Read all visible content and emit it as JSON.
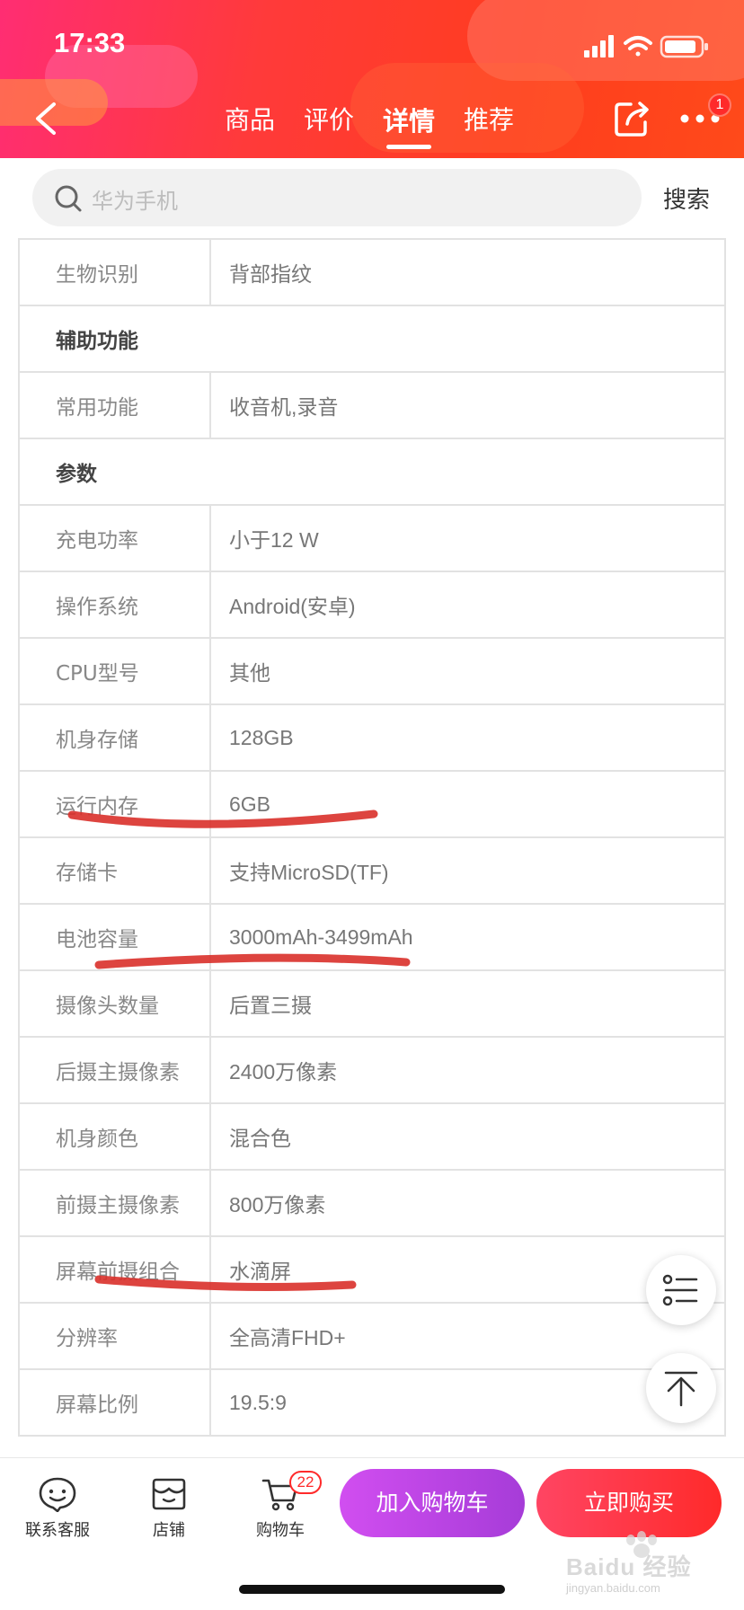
{
  "status_bar": {
    "time": "17:33"
  },
  "nav": {
    "tabs": [
      {
        "label": "商品"
      },
      {
        "label": "评价"
      },
      {
        "label": "详情"
      },
      {
        "label": "推荐"
      }
    ],
    "active_tab": "详情",
    "more_badge": "1"
  },
  "search": {
    "placeholder": "华为手机",
    "button_label": "搜索"
  },
  "specs": {
    "rows": [
      {
        "label": "生物识别",
        "value": "背部指纹"
      },
      {
        "section": "辅助功能"
      },
      {
        "label": "常用功能",
        "value": "收音机,录音"
      },
      {
        "section": "参数"
      },
      {
        "label": "充电功率",
        "value": "小于12 W"
      },
      {
        "label": "操作系统",
        "value": "Android(安卓)"
      },
      {
        "label": "CPU型号",
        "value": "其他"
      },
      {
        "label": "机身存储",
        "value": "128GB"
      },
      {
        "label": "运行内存",
        "value": "6GB"
      },
      {
        "label": "存储卡",
        "value": "支持MicroSD(TF)"
      },
      {
        "label": "电池容量",
        "value": "3000mAh-3499mAh"
      },
      {
        "label": "摄像头数量",
        "value": "后置三摄"
      },
      {
        "label": "后摄主摄像素",
        "value": "2400万像素"
      },
      {
        "label": "机身颜色",
        "value": "混合色"
      },
      {
        "label": "前摄主摄像素",
        "value": "800万像素"
      },
      {
        "label": "屏幕前摄组合",
        "value": "水滴屏"
      },
      {
        "label": "分辨率",
        "value": "全高清FHD+"
      },
      {
        "label": "屏幕比例",
        "value": "19.5:9"
      }
    ],
    "annotation_color": "#d9302a"
  },
  "bottom_bar": {
    "customer_service_label": "联系客服",
    "store_label": "店铺",
    "cart_label": "购物车",
    "cart_count": "22",
    "add_to_cart_label": "加入购物车",
    "buy_now_label": "立即购买"
  },
  "watermark": {
    "text": "Baidu 经验",
    "sub": "jingyan.baidu.com"
  }
}
